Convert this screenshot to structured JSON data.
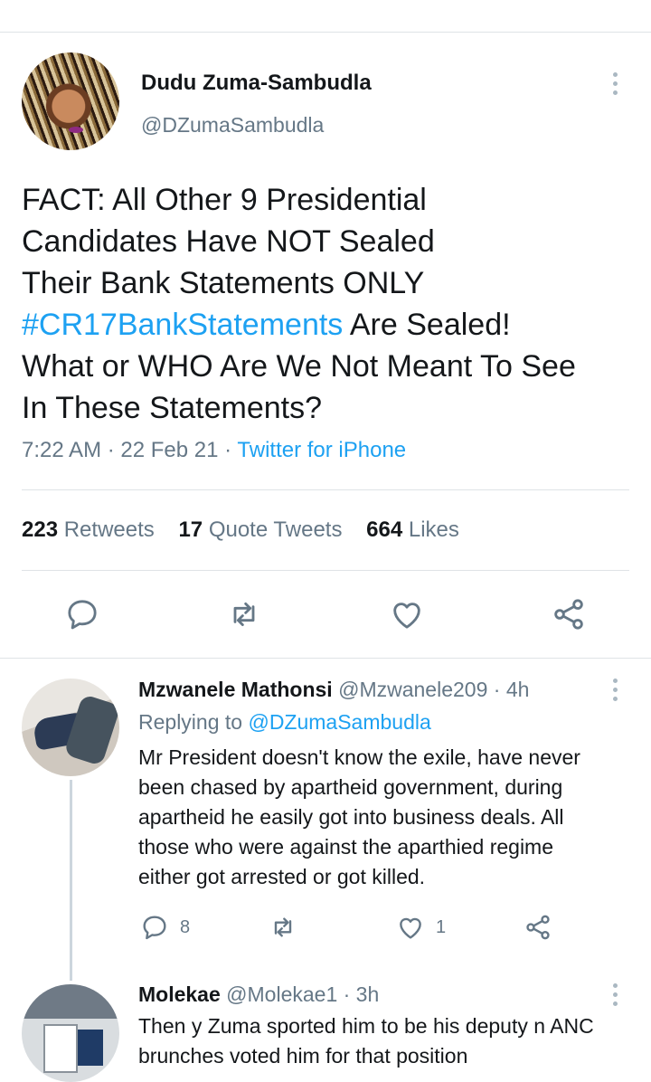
{
  "main_tweet": {
    "author_name": "Dudu Zuma-Sambudla",
    "author_handle": "@DZumaSambudla",
    "text_lines": [
      "FACT: All Other 9 Presidential",
      "Candidates Have NOT Sealed",
      "Their Bank Statements ONLY"
    ],
    "hashtag": "#CR17BankStatements",
    "hashtag_rest": " Are Sealed!",
    "text_lines_after": [
      "What or WHO Are We Not Meant To See",
      "In These Statements?"
    ],
    "time": "7:22 AM",
    "date": "22 Feb 21",
    "separator": "·",
    "source": "Twitter for iPhone",
    "stats": {
      "retweets_count": "223",
      "retweets_label": "Retweets",
      "quotes_count": "17",
      "quotes_label": "Quote Tweets",
      "likes_count": "664",
      "likes_label": "Likes"
    },
    "icons": [
      "reply-icon",
      "retweet-icon",
      "like-icon",
      "share-icon"
    ]
  },
  "replies": [
    {
      "name": "Mzwanele Mathonsi",
      "handle": "@Mzwanele209",
      "time": "· 4h",
      "replying_prefix": "Replying to",
      "replying_to": "@DZumaSambudla",
      "text_lines": [
        "Mr President doesn't know the exile, have never",
        "been chased by apartheid government, during",
        "apartheid he easily got into business deals. All",
        "those who were against the aparthied regime",
        "either got arrested or got killed."
      ],
      "reply_count": "8",
      "retweet_count": "",
      "like_count": "1"
    },
    {
      "name": "Molekae",
      "handle": "@Molekae1",
      "time": "· 3h",
      "text_lines": [
        "Then y Zuma sported him to be his deputy n ANC",
        "brunches voted him for that position"
      ]
    }
  ],
  "colors": {
    "accent": "#1da1f2",
    "text": "#14171a",
    "muted": "#657786",
    "divider": "#dfe3e6",
    "icon": "#657786"
  }
}
